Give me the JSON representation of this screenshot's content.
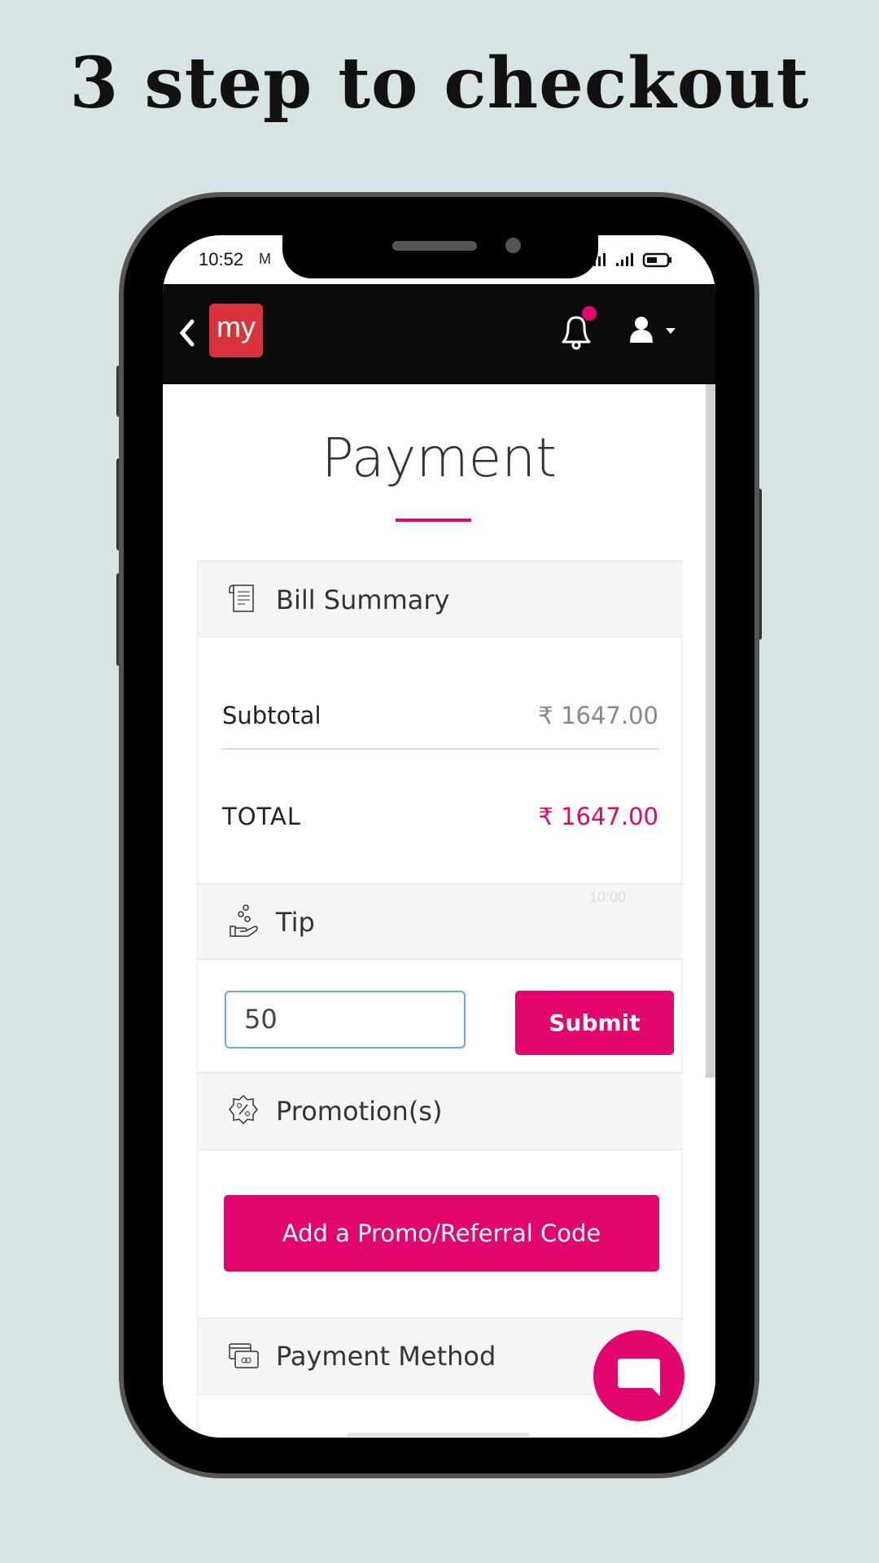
{
  "headline": "3 step to checkout",
  "status_bar": {
    "time": "10:52"
  },
  "app_bar": {
    "logo_text": "my",
    "notification_dot": true
  },
  "page": {
    "title": "Payment",
    "bill_summary": {
      "heading": "Bill Summary",
      "subtotal_label": "Subtotal",
      "subtotal_value": "₹ 1647.00",
      "total_label": "TOTAL",
      "total_value": "₹ 1647.00",
      "ghost_text": "10:00"
    },
    "tip": {
      "heading": "Tip",
      "input_value": "50",
      "submit_label": "Submit"
    },
    "promotions": {
      "heading": "Promotion(s)",
      "add_code_label": "Add a Promo/Referral Code"
    },
    "payment_method": {
      "heading": "Payment Method"
    }
  },
  "colors": {
    "accent": "#e2056e",
    "background": "#d7e3e4",
    "logo": "#d9323a"
  }
}
